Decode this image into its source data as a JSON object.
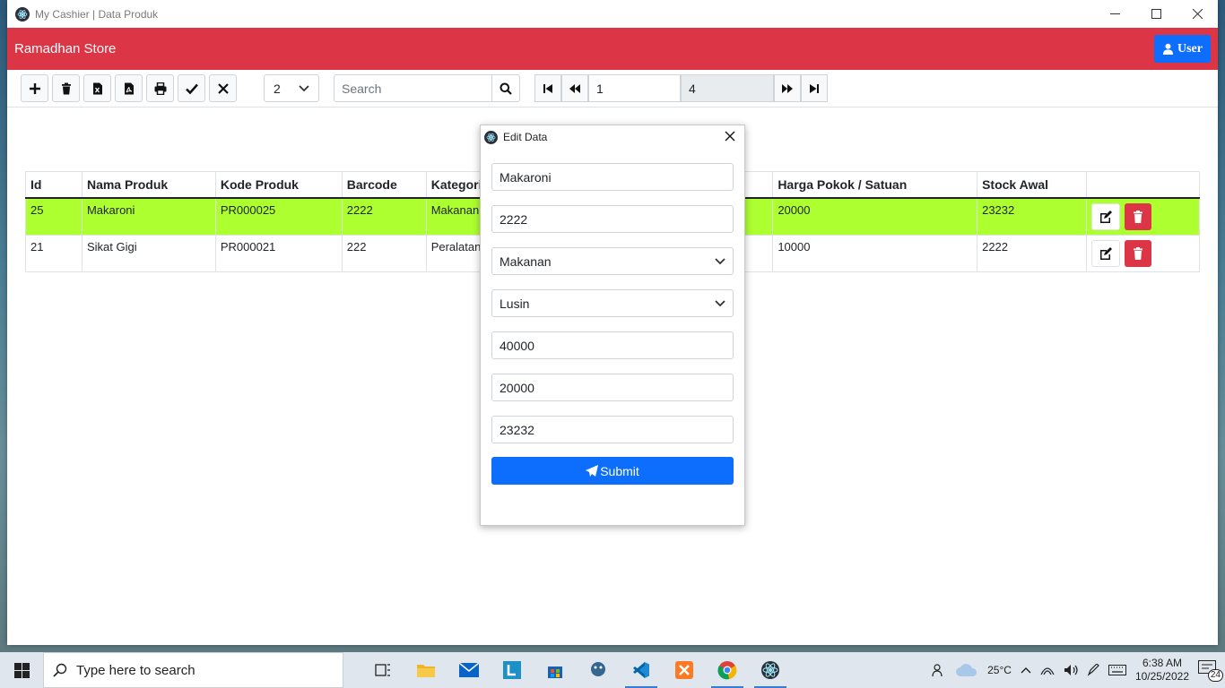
{
  "window": {
    "title": "My Cashier | Data Produk"
  },
  "navbar": {
    "brand": "Ramadhan Store",
    "user_label": "User"
  },
  "toolbar": {
    "per_page": "2",
    "search_placeholder": "Search",
    "current_page": "1",
    "total_pages": "4"
  },
  "table": {
    "headers": [
      "Id",
      "Nama Produk",
      "Kode Produk",
      "Barcode",
      "Kategori",
      "Harga Pokok / Satuan",
      "Stock Awal"
    ],
    "rows": [
      {
        "id": "25",
        "nama": "Makaroni",
        "kode": "PR000025",
        "barcode": "2222",
        "kategori": "Makanan",
        "harga": "20000",
        "stock": "23232"
      },
      {
        "id": "21",
        "nama": "Sikat Gigi",
        "kode": "PR000021",
        "barcode": "222",
        "kategori": "Peralatan",
        "harga": "10000",
        "stock": "2222"
      }
    ]
  },
  "modal": {
    "title": "Edit Data",
    "fields": {
      "nama": "Makaroni",
      "barcode": "2222",
      "kategori": "Makanan",
      "satuan": "Lusin",
      "harga_jual": "40000",
      "harga_pokok": "20000",
      "stock": "23232"
    },
    "submit_label": "Submit"
  },
  "taskbar": {
    "search_placeholder": "Type here to search",
    "weather": "25°C",
    "time": "6:38 AM",
    "date": "10/25/2022",
    "notifications": "24"
  },
  "colors": {
    "navbar": "#dc3545",
    "primary": "#0d6efd",
    "selected_row": "#adff2f"
  }
}
